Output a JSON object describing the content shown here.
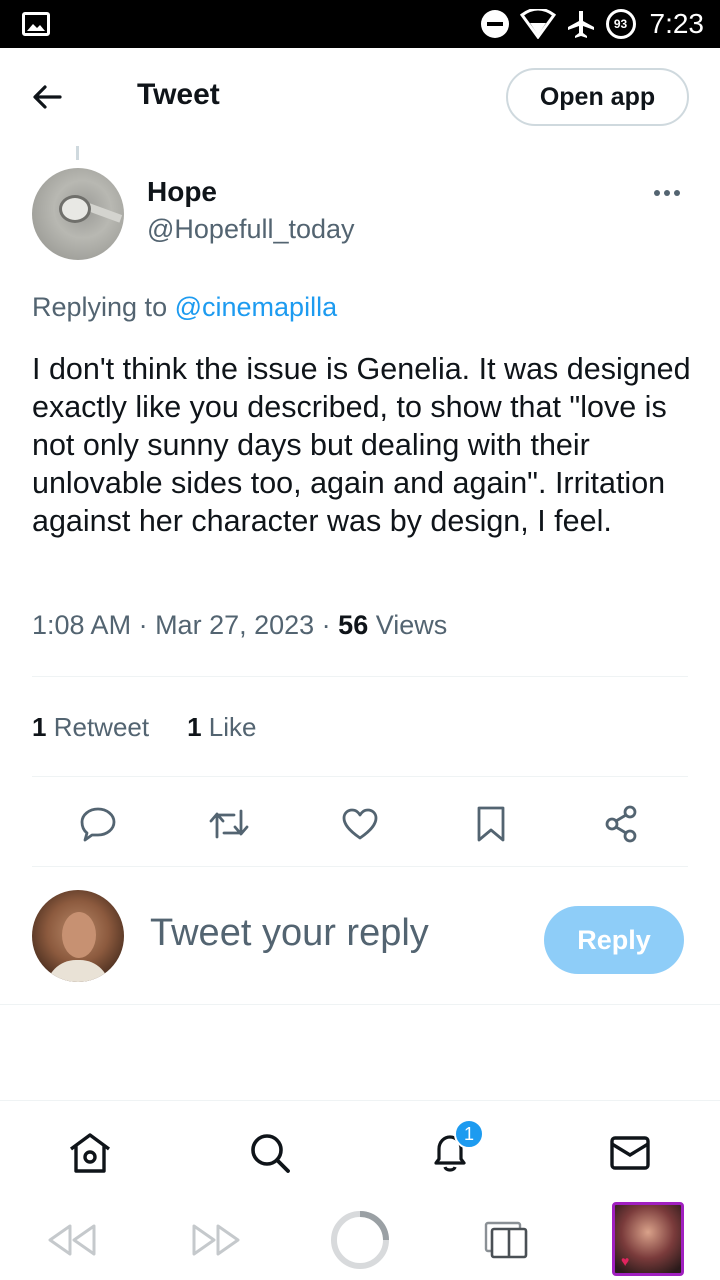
{
  "status_bar": {
    "time": "7:23",
    "battery": "93"
  },
  "header": {
    "title": "Tweet",
    "open_app_label": "Open app"
  },
  "tweet": {
    "author_name": "Hope",
    "author_handle": "@Hopefull_today",
    "replying_prefix": "Replying to",
    "replying_to": "@cinemapilla",
    "text": "I don't think the issue is Genelia. It was designed exactly like you described, to show that \"love is not only sunny days but dealing with their unlovable sides too, again and again\". Irritation against her character was by design, I feel.",
    "time": "1:08 AM",
    "date": "Mar 27, 2023",
    "views_count": "56",
    "views_label": "Views",
    "retweets_count": "1",
    "retweets_label": "Retweet",
    "likes_count": "1",
    "likes_label": "Like"
  },
  "actions": [
    "reply-icon",
    "retweet-icon",
    "like-icon",
    "bookmark-icon",
    "share-icon"
  ],
  "composer": {
    "placeholder": "Tweet your reply",
    "reply_label": "Reply"
  },
  "bottom_nav": {
    "items": [
      "home-icon",
      "search-icon",
      "notifications-icon",
      "messages-icon"
    ],
    "notification_badge": "1"
  },
  "colors": {
    "accent": "#1d9bf0",
    "secondary_text": "#536471",
    "reply_button_disabled": "#8ecdf8"
  }
}
